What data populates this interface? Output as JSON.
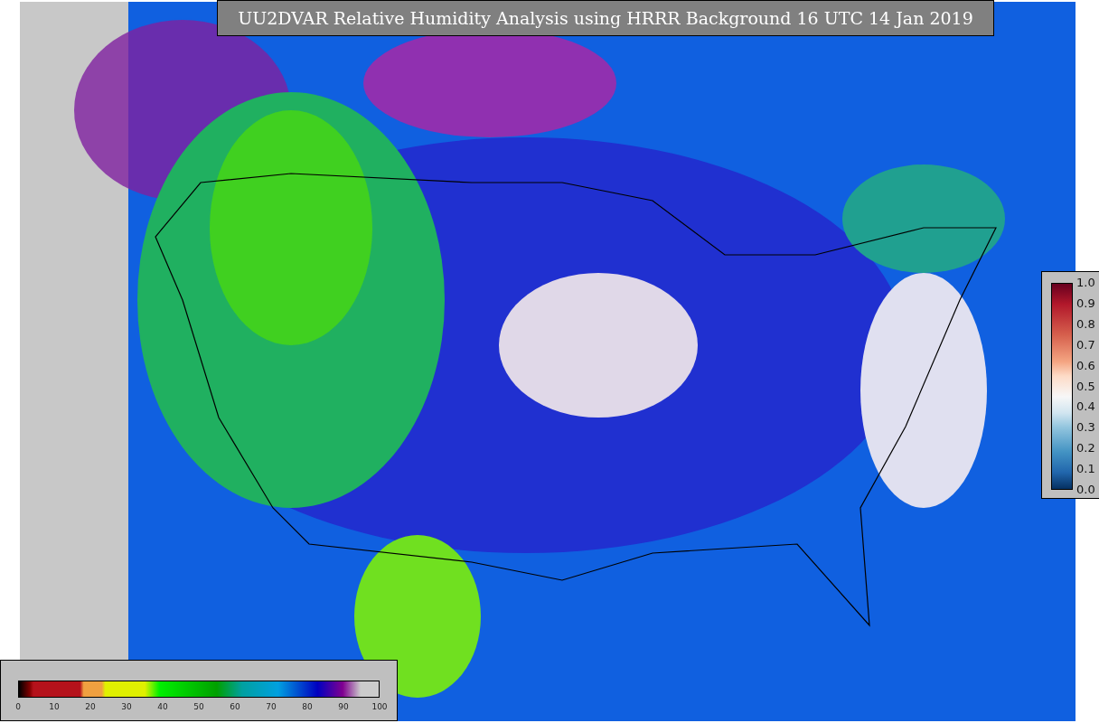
{
  "title": "UU2DVAR Relative Humidity Analysis using HRRR Background 16 UTC 14 Jan 2019",
  "humidity_colorbar": {
    "ticks": [
      "0",
      "10",
      "20",
      "30",
      "40",
      "50",
      "60",
      "70",
      "80",
      "90",
      "100"
    ]
  },
  "station_colorbar": {
    "ticks": [
      "1.0",
      "0.9",
      "0.8",
      "0.7",
      "0.6",
      "0.5",
      "0.4",
      "0.3",
      "0.2",
      "0.1",
      "0.0"
    ]
  }
}
